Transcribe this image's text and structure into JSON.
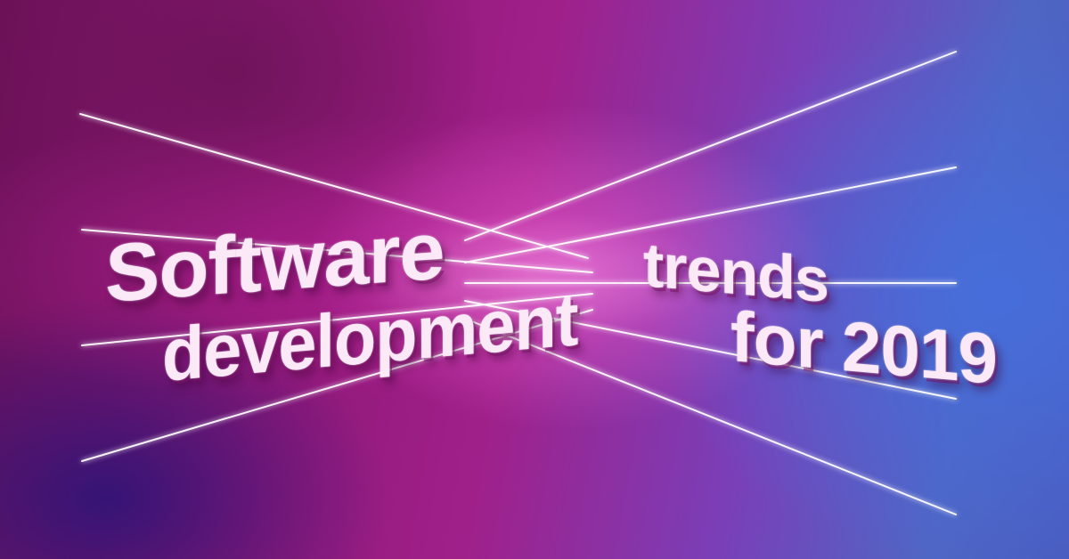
{
  "headline": {
    "line1": "Software",
    "line2": "development",
    "line3": "trends",
    "line4": "for 2019"
  },
  "colors": {
    "background_left": "#8e1876",
    "background_center": "#a0208a",
    "background_right": "#4a5cc0",
    "ray": "#ffffff",
    "ray_glow": "#ff7be6",
    "text": "#fbe9f8"
  }
}
